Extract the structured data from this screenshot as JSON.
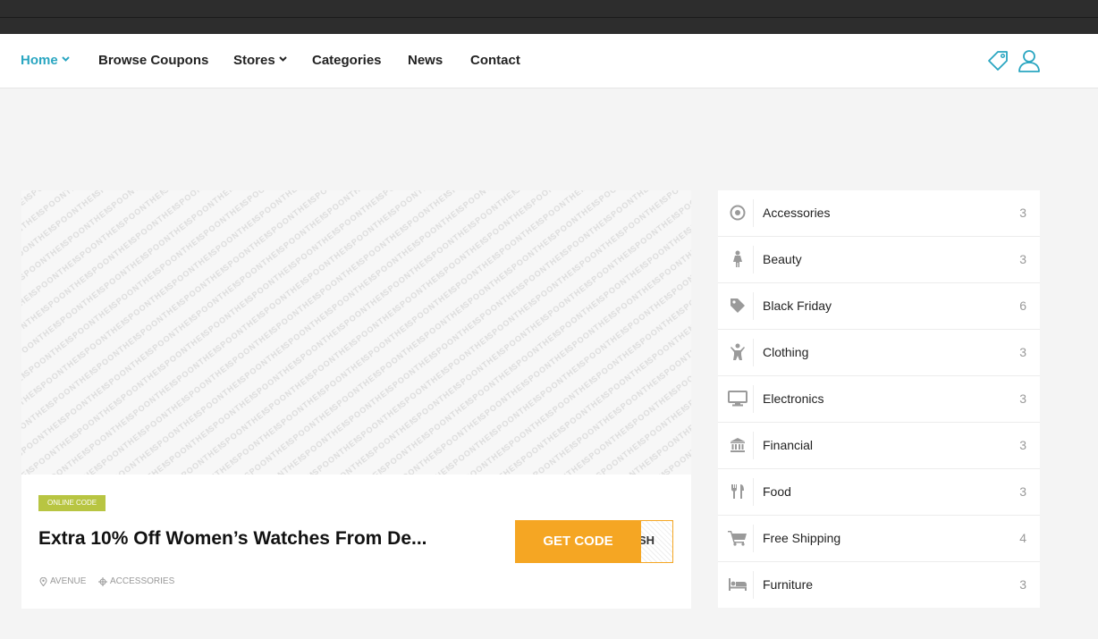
{
  "nav": {
    "home": "Home",
    "browse": "Browse Coupons",
    "stores": "Stores",
    "categories": "Categories",
    "news": "News",
    "contact": "Contact"
  },
  "coupon": {
    "image_watermark": "SPOONTHEMES",
    "badge": "ONLINE CODE",
    "title": "Extra 10% Off Women’s Watches From De...",
    "button_label": "GET CODE",
    "code_peek": "SH",
    "store": "AVENUE",
    "category": "ACCESSORIES"
  },
  "categories": [
    {
      "name": "Accessories",
      "count": "3",
      "icon": "target-icon"
    },
    {
      "name": "Beauty",
      "count": "3",
      "icon": "woman-icon"
    },
    {
      "name": "Black Friday",
      "count": "6",
      "icon": "tag-icon"
    },
    {
      "name": "Clothing",
      "count": "3",
      "icon": "child-icon"
    },
    {
      "name": "Electronics",
      "count": "3",
      "icon": "monitor-icon"
    },
    {
      "name": "Financial",
      "count": "3",
      "icon": "bank-icon"
    },
    {
      "name": "Food",
      "count": "3",
      "icon": "cutlery-icon"
    },
    {
      "name": "Free Shipping",
      "count": "4",
      "icon": "cart-icon"
    },
    {
      "name": "Furniture",
      "count": "3",
      "icon": "bed-icon"
    }
  ],
  "colors": {
    "accent": "#2aa6c1",
    "button": "#f5a623",
    "badge": "#b8c542",
    "topbar": "#2d2d2d",
    "icon": "#9a9a9a"
  }
}
